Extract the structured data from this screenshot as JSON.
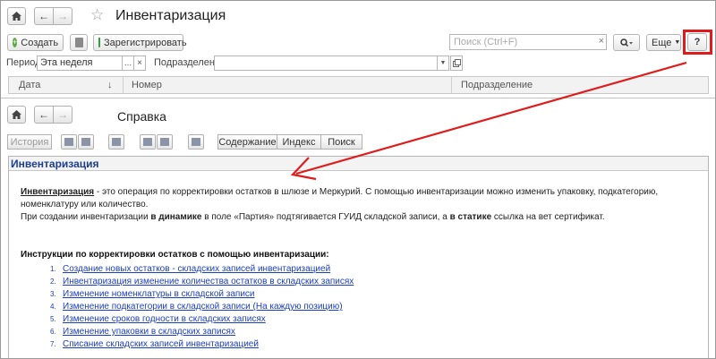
{
  "main_window": {
    "title": "Инвентаризация",
    "nav": {
      "home_icon": "home-icon",
      "back_icon": "arrow-left-icon",
      "forward_icon": "arrow-right-icon"
    },
    "toolbar": {
      "create_label": "Создать",
      "register_label": "Зарегистрировать",
      "search_placeholder": "Поиск (Ctrl+F)",
      "search_clear": "×",
      "more_label": "Еще",
      "help_label": "?"
    },
    "filters": {
      "period_label": "Период:",
      "period_value": "Эта неделя",
      "period_select": "...",
      "period_clear": "×",
      "division_label": "Подразделение:",
      "division_value": ""
    },
    "table": {
      "columns": [
        "Дата",
        "Номер",
        "Подразделение"
      ],
      "sort_indicator": "↓"
    }
  },
  "help_window": {
    "title": "Справка",
    "toolbar": {
      "history_label": "История",
      "contents_label": "Содержание",
      "index_label": "Индекс",
      "search_label": "Поиск"
    },
    "heading": "Инвентаризация",
    "intro_term": "Инвентаризация",
    "intro_rest": " - это операция по корректировки остатков в шлюзе и Меркурий. С помощью инвентаризации можно изменить упаковку, подкатегорию, номенклатуру или количество.",
    "dynamic_p1": "При создании инвентаризации ",
    "dynamic_b1": "в динамике",
    "dynamic_p2": " в поле «Партия» подтягивается ГУИД складской записи, а ",
    "dynamic_b2": "в статике",
    "dynamic_p3": " ссылка на вет сертификат.",
    "instructions_title": "Инструкции по корректировки остатков с помощью инвентаризации:",
    "links": [
      {
        "num": "1.",
        "text": "Создание новых остатков - складских записей инвентаризацией"
      },
      {
        "num": "2.",
        "text": "Инвентаризация изменение количества остатков в складских записях"
      },
      {
        "num": "3.",
        "text": "Изменение номенклатуры в складской записи"
      },
      {
        "num": "4.",
        "text": "Изменение подкатегории в складской записи (На каждую позицию)"
      },
      {
        "num": "5.",
        "text": "Изменение сроков годности в складских записях"
      },
      {
        "num": "6.",
        "text": "Изменение упаковки в складских записях"
      },
      {
        "num": "7.",
        "text": "Списание складских записей инвентаризацией"
      }
    ]
  },
  "annotation": {
    "color": "#e01b1b"
  }
}
